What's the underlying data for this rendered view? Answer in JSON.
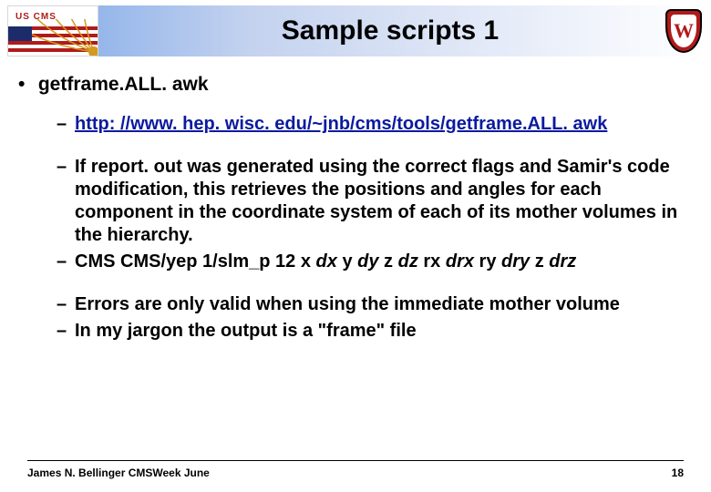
{
  "title": "Sample scripts 1",
  "logos": {
    "left_label": "US CMS",
    "left_name": "uscms-logo",
    "right_name": "uw-crest",
    "right_letter": "W"
  },
  "main_bullet": "getframe.ALL. awk",
  "sub": {
    "link": "http: //www. hep. wisc. edu/~jnb/cms/tools/getframe.ALL. awk",
    "p1": "If report. out was generated using the correct flags and Samir's code modification, this retrieves the positions and angles for each component in the coordinate system of each of its mother volumes in the hierarchy.",
    "p2_plain": "CMS CMS/yep 1/slm_p 12  x ",
    "p2_i1": "dx",
    "p2_mid1": " y ",
    "p2_i2": "dy",
    "p2_mid2": " z ",
    "p2_i3": "dz",
    "p2_mid3": " rx ",
    "p2_i4": "drx",
    "p2_mid4": " ry ",
    "p2_i5": "dry",
    "p2_mid5": " z ",
    "p2_i6": "drz",
    "p3": "Errors are only valid when using the immediate mother volume",
    "p4": "In my jargon the output is a \"frame\" file"
  },
  "footer": {
    "author": "James N. Bellinger CMSWeek June",
    "page": "18"
  }
}
